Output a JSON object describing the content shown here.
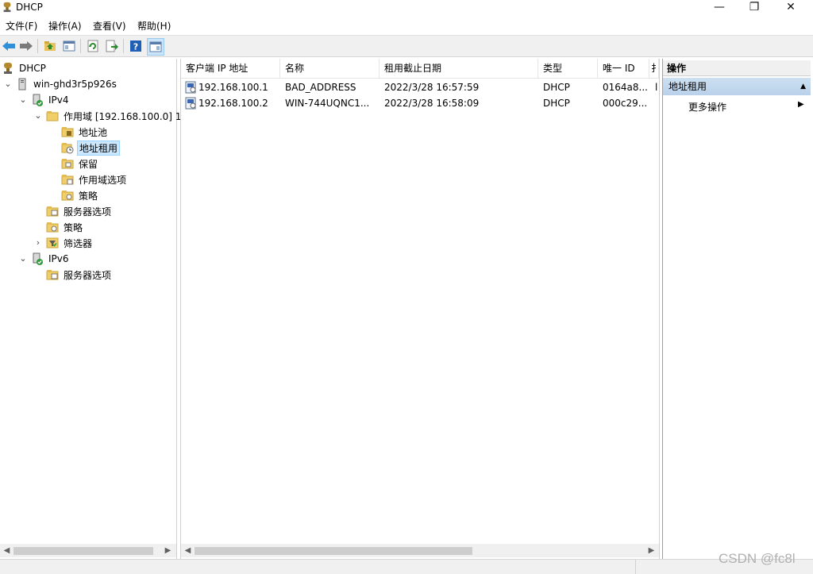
{
  "window": {
    "title": "DHCP",
    "minimize_glyph": "—",
    "maximize_glyph": "❐",
    "close_glyph": "✕"
  },
  "menu": [
    "文件(F)",
    "操作(A)",
    "查看(V)",
    "帮助(H)"
  ],
  "toolbar": {
    "icons": [
      "back-icon",
      "forward-icon",
      "up-folder-icon",
      "show-hide-tree-icon",
      "refresh-icon",
      "export-list-icon",
      "help-icon",
      "show-hide-action-pane-icon"
    ]
  },
  "tree": {
    "root": "DHCP",
    "server": "win-ghd3r5p926s",
    "ipv4": "IPv4",
    "scope": "作用域 [192.168.100.0] 1(",
    "address_pool": "地址池",
    "address_leases": "地址租用",
    "reservations": "保留",
    "scope_options": "作用域选项",
    "scope_policies": "策略",
    "server_options_v4": "服务器选项",
    "policies_v4": "策略",
    "filters": "筛选器",
    "ipv6": "IPv6",
    "server_options_v6": "服务器选项"
  },
  "list": {
    "columns": [
      "客户端 IP 地址",
      "名称",
      "租用截止日期",
      "类型",
      "唯一 ID",
      "扌"
    ],
    "rows": [
      {
        "ip": "192.168.100.1",
        "name": "BAD_ADDRESS",
        "expires": "2022/3/28 16:57:59",
        "type": "DHCP",
        "uid": "0164a8...",
        "extra": "l"
      },
      {
        "ip": "192.168.100.2",
        "name": "WIN-744UQNC1...",
        "expires": "2022/3/28 16:58:09",
        "type": "DHCP",
        "uid": "000c29...",
        "extra": ""
      }
    ]
  },
  "actions": {
    "header": "操作",
    "section": "地址租用",
    "more": "更多操作"
  },
  "watermark": "CSDN @fc8l",
  "colors": {
    "selection": "#cce8ff",
    "action_section": "#bcd4ec",
    "toolbar_bg": "#f0f0f0"
  }
}
